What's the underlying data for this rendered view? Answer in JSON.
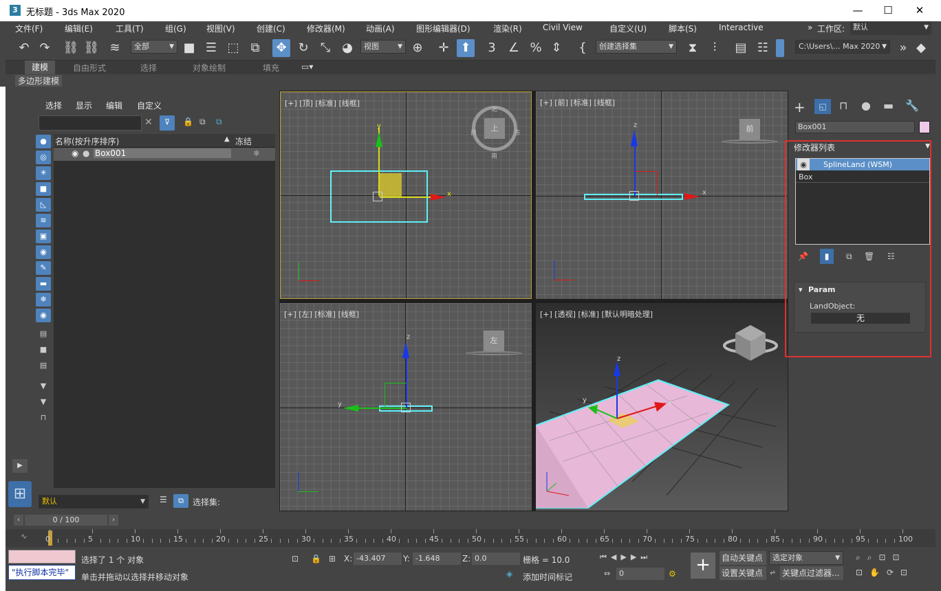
{
  "window": {
    "app_icon": "3",
    "title": "无标题 - 3ds Max 2020",
    "minimize": "—",
    "maximize": "☐",
    "close": "✕"
  },
  "menu": [
    "文件(F)",
    "编辑(E)",
    "工具(T)",
    "组(G)",
    "视图(V)",
    "创建(C)",
    "修改器(M)",
    "动画(A)",
    "图形编辑器(D)",
    "渲染(R)",
    "Civil View",
    "自定义(U)",
    "脚本(S)",
    "Interactive"
  ],
  "workspace": {
    "label": "工作区:",
    "value": "默认",
    "more": "»"
  },
  "toolbar": {
    "filter": "全部",
    "coord": "视图",
    "selection_set": "创建选择集",
    "path": "C:\\Users\\… Max 2020"
  },
  "ribbon": {
    "tabs": [
      "建模",
      "自由形式",
      "选择",
      "对象绘制",
      "填充"
    ],
    "active": "建模",
    "sub": "多边形建模"
  },
  "scene_explorer": {
    "menus": [
      "选择",
      "显示",
      "编辑",
      "自定义"
    ],
    "col_name": "名称(按升序排序)",
    "col_freeze": "冻结",
    "row_name": "Box001",
    "layer": "默认",
    "selset_label": "选择集:"
  },
  "viewports": {
    "top": "[+] [顶] [标准] [线框]",
    "front": "[+] [前] [标准] [线框]",
    "left": "[+] [左] [标准] [线框]",
    "persp": "[+] [透视] [标准] [默认明暗处理]",
    "cube_top": "上",
    "cube_top_n": "北",
    "cube_top_s": "南",
    "cube_top_w": "西",
    "cube_top_e": "东",
    "cube_front": "前",
    "cube_left": "左",
    "axis_x": "x",
    "axis_y": "y",
    "axis_z": "z",
    "colors": {
      "selection": "#5ef0f8",
      "x_axis": "#e01818",
      "y_axis": "#18c018",
      "z_axis": "#1838e8",
      "box_fill": "#e8b8d8"
    }
  },
  "command_panel": {
    "object_name": "Box001",
    "modifier_list": "修改器列表",
    "stack": [
      "SplineLand (WSM)",
      "Box"
    ],
    "rollout_title": "Param",
    "param_label": "LandObject:",
    "param_value": "无",
    "color_swatch": "#f0c8e8"
  },
  "time": {
    "frame": "0 / 100",
    "ticks": [
      "0",
      "5",
      "10",
      "15",
      "20",
      "25",
      "30",
      "35",
      "40",
      "45",
      "50",
      "55",
      "60",
      "65",
      "70",
      "75",
      "80",
      "85",
      "90",
      "95",
      "100"
    ]
  },
  "status": {
    "maxscript": "\"执行脚本完毕\"",
    "selected": "选择了 1 个 对象",
    "prompt": "单击并拖动以选择并移动对象",
    "x_label": "X:",
    "x_val": "-43.407",
    "y_label": "Y:",
    "y_val": "-1.648",
    "z_label": "Z:",
    "z_val": "0.0",
    "grid": "栅格 = 10.0",
    "add_time_tag": "添加时间标记",
    "auto_key": "自动关键点",
    "set_key": "设置关键点",
    "selected_obj": "选定对象",
    "key_filters": "关键点过滤器...",
    "frame_field": "0"
  }
}
